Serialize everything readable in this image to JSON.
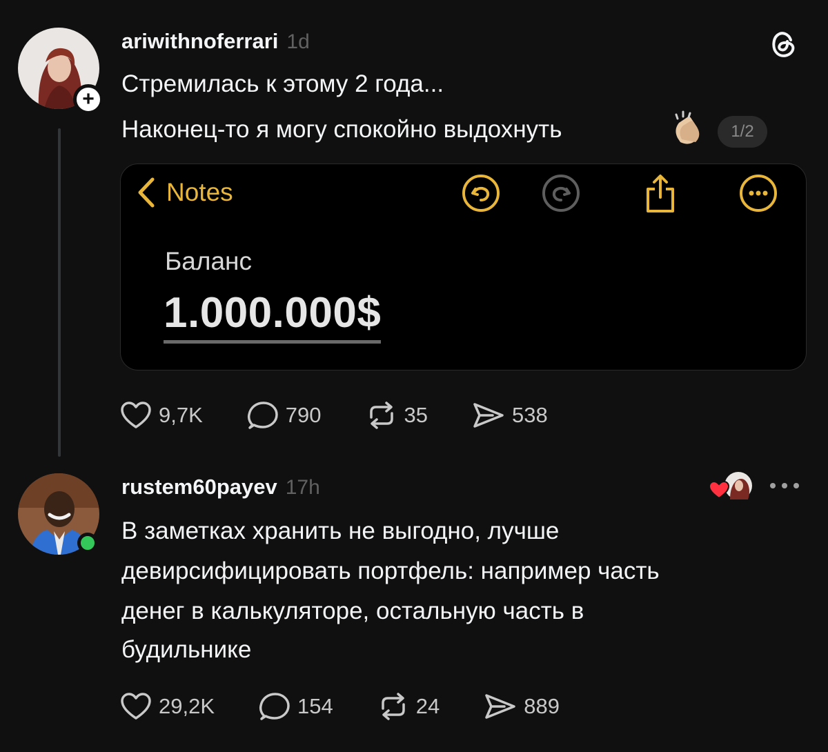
{
  "post": {
    "username": "ariwithnoferrari",
    "time": "1d",
    "lines": [
      "Стремилась к этому 2 года...",
      "Наконец-то я могу спокойно выдохнуть"
    ],
    "media_counter": "1/2",
    "note": {
      "back_label": "Notes",
      "label": "Баланс",
      "amount": "1.000.000$"
    },
    "stats": {
      "likes": "9,7K",
      "replies": "790",
      "reposts": "35",
      "shares": "538"
    }
  },
  "reply": {
    "username": "rustem60payev",
    "time": "17h",
    "lines": [
      "В заметках хранить не выгодно, лучше",
      "девирсифицировать портфель: например часть",
      "денег в калькуляторе, остальную часть в",
      "будильнике"
    ],
    "stats": {
      "likes": "29,2K",
      "replies": "154",
      "reposts": "24",
      "shares": "889"
    }
  },
  "icons": {
    "brand": "threads-icon",
    "accent": "#e8b63a",
    "heart_red": "#ff3040"
  }
}
